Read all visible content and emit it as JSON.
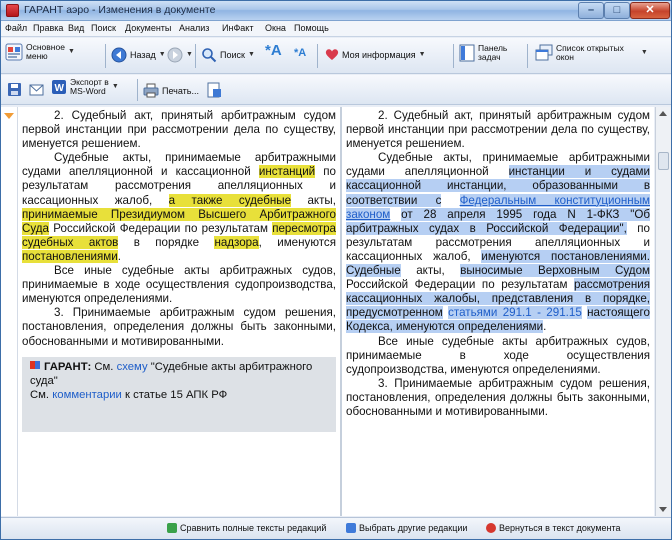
{
  "window": {
    "title": "ГАРАНТ аэро - Изменения в документе"
  },
  "menu": [
    "Файл",
    "Правка",
    "Вид",
    "Поиск",
    "Документы",
    "Анализ",
    "ИнФакт",
    "Окна",
    "Помощь"
  ],
  "toolbar1": {
    "main_menu": [
      "Основное",
      "меню"
    ],
    "back": "Назад",
    "search": "Поиск",
    "my_info": "Моя информация",
    "task_panel": [
      "Панель",
      "задач"
    ],
    "open_windows": [
      "Список открытых",
      "окон"
    ]
  },
  "toolbar2": {
    "export": [
      "Экспорт в",
      "MS-Word"
    ],
    "print": "Печать..."
  },
  "left_doc": {
    "p1": "2. Судебный акт, принятый арбитражным судом первой инстанции при рассмотрении дела по существу, именуется решением.",
    "p2_a": "Судебные акты, принимаемые арбитражными судами апелляционной и кассационной ",
    "p2_hl1": "инстанций",
    "p2_b": " по результатам рассмотрения апелляционных и кассационных жалоб, ",
    "p2_hl2": "а также судебные",
    "p2_c": " акты, ",
    "p2_hl3": "принимаемые Президиумом Высшего Арбитражного Суда",
    "p2_d": " Российской Федерации по результатам ",
    "p2_hl4": "пересмотра судебных актов",
    "p2_e": " в порядке ",
    "p2_hl5": "надзора",
    "p2_f": ", именуются ",
    "p2_hl6": "постановлениями",
    "p2_g": ".",
    "p3": "Все иные судебные акты арбитражных судов, принимаемые в ходе осуществления судопроизводства, именуются определениями.",
    "p4": "3. Принимаемые арбитражным судом решения, постановления, определения должны быть законными, обоснованными и мотивированными.",
    "note": {
      "label": "ГАРАНТ:",
      "see1": "См.",
      "link1": "схему",
      "text1": "\"Судебные акты арбитражного суда\"",
      "see2": "См.",
      "link2": "комментарии",
      "text2": "к статье 15 АПК РФ"
    }
  },
  "right_doc": {
    "p1": "2. Судебный акт, принятый арбитражным судом первой инстанции при рассмотрении дела по существу, именуется решением.",
    "p2_a": "Судебные акты, принимаемые арбитражными судами апелляционной ",
    "p2_hl1": "инстанции и судами кассационной инстанции, образованными в соответствии с",
    "p2_link": "Федеральным конституционным законом",
    "p2_hl2": "от 28 апреля 1995 года N 1-ФКЗ \"Об арбитражных судах в Российской Федерации\",",
    "p2_b": " по результатам рассмотрения апелляционных и кассационных жалоб, ",
    "p2_hl3": "именуются постановлениями. Судебные",
    "p2_c": " акты, ",
    "p2_hl4": "выносимые Верховным Судом",
    "p2_d": " Российской Федерации по результатам ",
    "p2_hl5": "рассмотрения кассационных жалобы, представления в порядке, предусмотренном",
    "p2_link2": "статьями 291.1 - 291.15",
    "p2_hl6": "настоящего Кодекса, именуются определениями",
    "p2_e": ".",
    "p3": "Все иные судебные акты арбитражных судов, принимаемые в ходе осуществления судопроизводства, именуются определениями.",
    "p4": "3. Принимаемые арбитражным судом решения, постановления, определения должны быть законными, обоснованными и мотивированными."
  },
  "bottom": {
    "compare": "Сравнить полные тексты редакций",
    "choose": "Выбрать другие редакции",
    "return": "Вернуться в текст документа"
  }
}
